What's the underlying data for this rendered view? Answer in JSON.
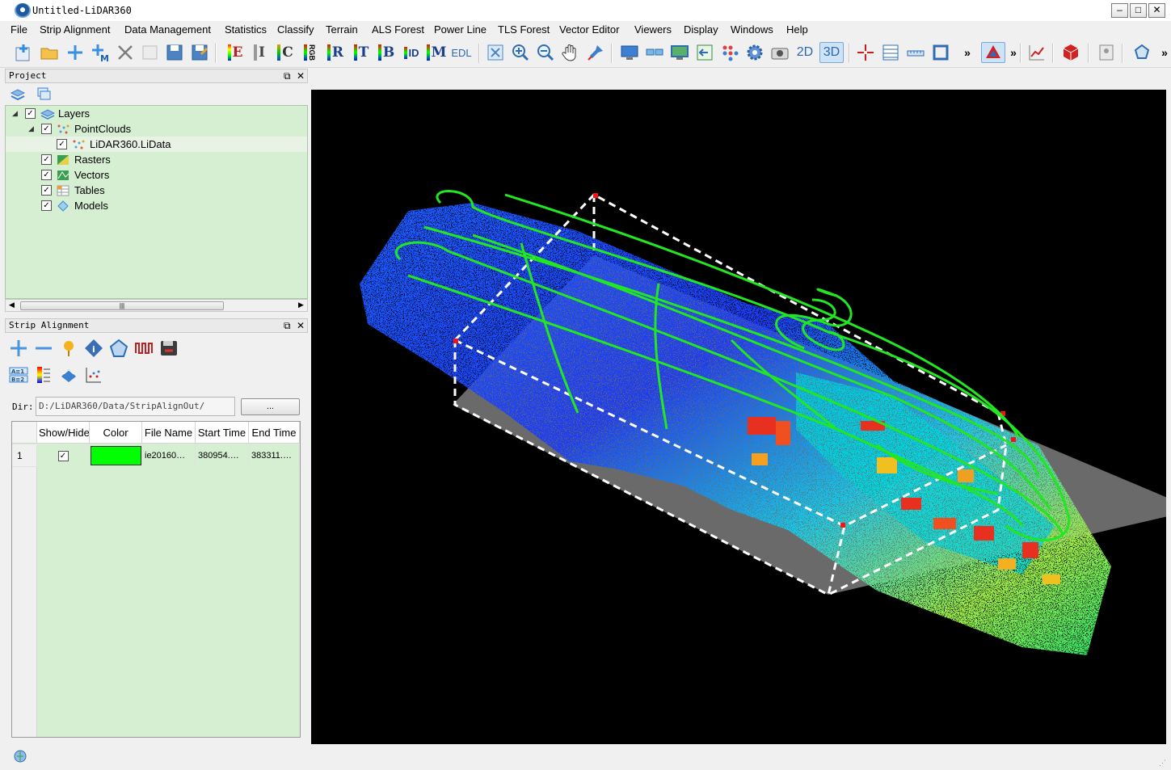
{
  "window": {
    "title": "Untitled-LiDAR360"
  },
  "menu": [
    "File",
    "Strip Alignment",
    "Data Management",
    "Statistics",
    "Classify",
    "Terrain",
    "ALS Forest",
    "Power Line",
    "TLS Forest",
    "Vector Editor",
    "Viewers",
    "Display",
    "Windows",
    "Help"
  ],
  "toolbar": {
    "color_modes": [
      "E",
      "I",
      "C",
      "RGB",
      "R",
      "T",
      "B",
      "ID",
      "M",
      "EDL"
    ],
    "view_2d": "2D",
    "view_3d": "3D",
    "overflow": "»"
  },
  "project_panel": {
    "title": "Project",
    "tree": [
      {
        "label": "Layers",
        "checked": true
      },
      {
        "label": "PointClouds",
        "checked": true
      },
      {
        "label": "LiDAR360.LiData",
        "checked": true
      },
      {
        "label": "Rasters",
        "checked": true
      },
      {
        "label": "Vectors",
        "checked": true
      },
      {
        "label": "Tables",
        "checked": true
      },
      {
        "label": "Models",
        "checked": true
      }
    ]
  },
  "strip_panel": {
    "title": "Strip Alignment",
    "dir_label": "Dir:",
    "dir_value": "D:/LiDAR360/Data/StripAlignOut/",
    "browse_label": "...",
    "columns": [
      "Show/Hide",
      "Color",
      "File Name",
      "Start Time",
      "End Time"
    ],
    "rows": [
      {
        "index": "1",
        "visible": true,
        "color": "#00ff00",
        "file": "ie20160…",
        "start": "380954.…",
        "end": "383311.…"
      }
    ]
  },
  "colors": {
    "tree_bg": "#d6efd2",
    "viewport_bg": "#000000",
    "trajectory": "#22e622",
    "bbox": "#ffffff"
  }
}
